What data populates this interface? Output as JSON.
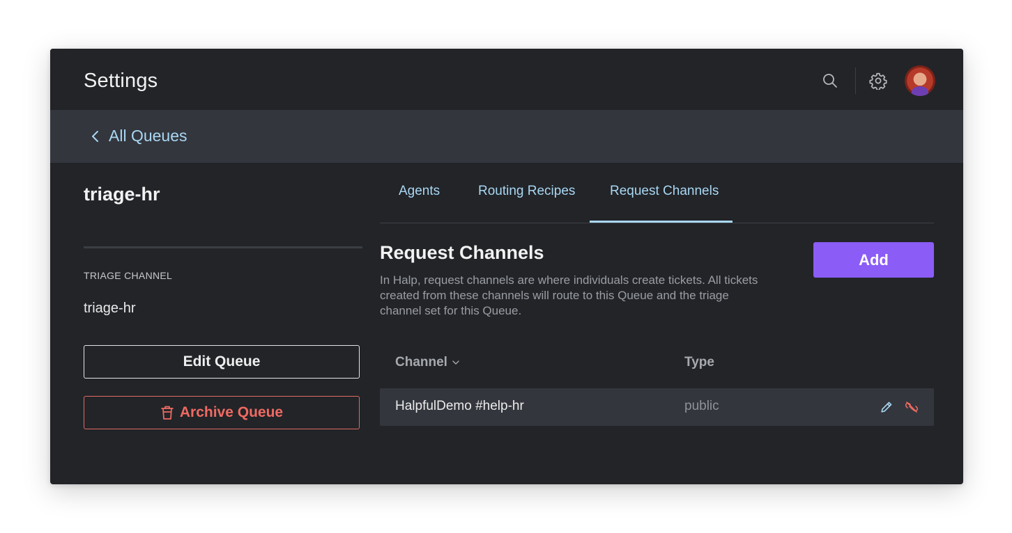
{
  "header": {
    "title": "Settings",
    "icons": [
      "search-icon",
      "gear-icon"
    ]
  },
  "breadcrumb": {
    "label": "All Queues",
    "icon": "chevron-left-icon"
  },
  "queue": {
    "name": "triage-hr",
    "triage_channel_label": "TRIAGE CHANNEL",
    "triage_channel_value": "triage-hr",
    "edit_label": "Edit Queue",
    "archive_label": "Archive Queue"
  },
  "tabs": [
    {
      "label": "Agents",
      "active": false
    },
    {
      "label": "Routing Recipes",
      "active": false
    },
    {
      "label": "Request Channels",
      "active": true
    }
  ],
  "section": {
    "title": "Request Channels",
    "description": "In Halp, request channels are where individuals create tickets. All tickets created from these channels will route to this Queue and the triage channel set for this Queue.",
    "add_label": "Add"
  },
  "table": {
    "columns": [
      "Channel",
      "Type"
    ],
    "rows": [
      {
        "channel": "HalpfulDemo #help-hr",
        "type": "public",
        "actions": [
          "pencil-icon",
          "unlink-icon"
        ]
      }
    ]
  },
  "colors": {
    "background": "#222428",
    "subheader": "#33363d",
    "accent_link": "#a9d7f3",
    "primary_button": "#8b5cf6",
    "danger": "#ef6a62"
  }
}
